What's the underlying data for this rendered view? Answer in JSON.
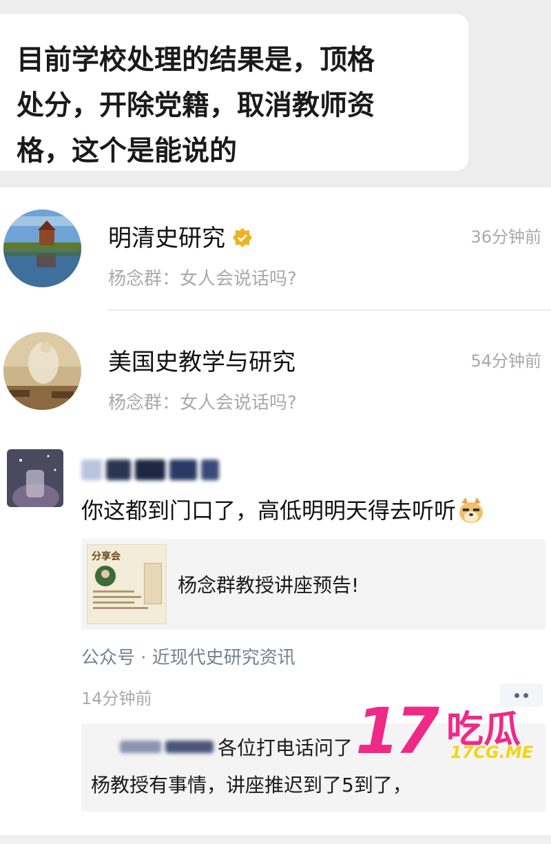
{
  "chat": {
    "lines": [
      "目前学校处理的结果是，顶格",
      "处分，开除党籍，取消教师资",
      "格，这个是能说的"
    ]
  },
  "chat_list": [
    {
      "name": "明清史研究",
      "verified": true,
      "time": "36分钟前",
      "preview": "杨念群：女人会说话吗?",
      "avatar_icon": "lake-landscape-avatar"
    },
    {
      "name": "美国史教学与研究",
      "verified": false,
      "time": "54分钟前",
      "preview": "杨念群：女人会说话吗?",
      "avatar_icon": "painting-avatar"
    }
  ],
  "moment": {
    "text": "你这都到门口了，高低明明天得去听听",
    "emoji": "doge-emoji",
    "share": {
      "thumb_header": "分享会",
      "title": "杨念群教授讲座预告!"
    },
    "source": "公众号 · 近现代史研究资讯",
    "time": "14分钟前",
    "comment": {
      "line1": "各位打电话问了",
      "line2": "杨教授有事情，讲座推迟到了5到",
      "line2_suffix": "了，"
    }
  },
  "watermark": {
    "number": "17",
    "text": "吃瓜",
    "site": "17CG.ME"
  },
  "colors": {
    "accent_pink": "#ee2a86",
    "watermark_yellow": "#f1d416",
    "link_blue": "#777f8f",
    "verified_gold": "#f0b21f"
  }
}
